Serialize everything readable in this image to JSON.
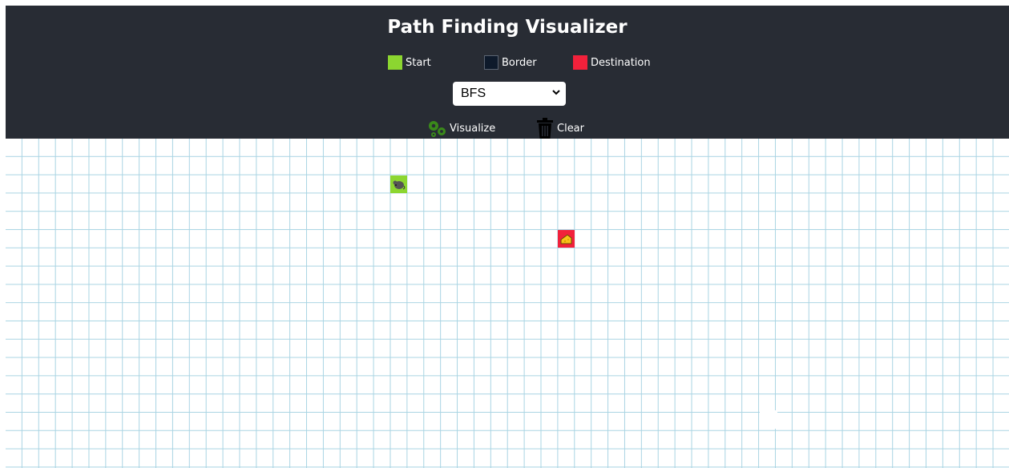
{
  "header": {
    "title": "Path Finding Visualizer",
    "background": "#282c34"
  },
  "legend": {
    "start_label": "Start",
    "border_label": "Border",
    "destination_label": "Destination",
    "start_color": "#8cd630",
    "border_color": "#0e1a2b",
    "destination_color": "#f2213b"
  },
  "algorithm_select": {
    "selected": "BFS"
  },
  "actions": {
    "visualize_label": "Visualize",
    "clear_label": "Clear",
    "visualize_icon": "gears-icon",
    "clear_icon": "trash-icon"
  },
  "grid": {
    "line_color": "#a9d4e3",
    "start_icon": "rat-icon",
    "destination_icon": "cheese-icon"
  }
}
